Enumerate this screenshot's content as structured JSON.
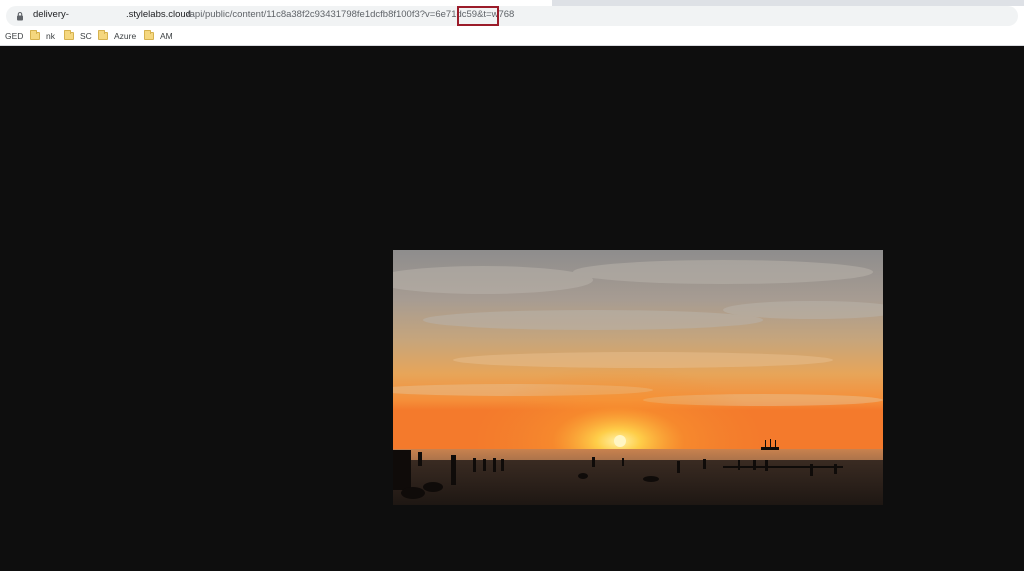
{
  "browser": {
    "url": {
      "host_prefix": "delivery-",
      "host_suffix": ".stylelabs.cloud",
      "path": "/api/public/content/11c8a38f2c93431798fe1dcfb8f100f3?v=6e71dc59&t=w768",
      "highlighted_param": "t=w768"
    },
    "bookmarks": [
      {
        "label": "GED",
        "icon": "none"
      },
      {
        "label": "nk",
        "icon": "folder-icon"
      },
      {
        "label": "SC",
        "icon": "folder-icon"
      },
      {
        "label": "Azure",
        "icon": "folder-icon"
      },
      {
        "label": "AM",
        "icon": "folder-icon"
      }
    ]
  },
  "viewer": {
    "background": "#0e0e0e",
    "image": {
      "subject": "sunset-beach-photo"
    }
  },
  "colors": {
    "highlight_border": "#9b1c2a",
    "folder": "#f5d77f"
  }
}
